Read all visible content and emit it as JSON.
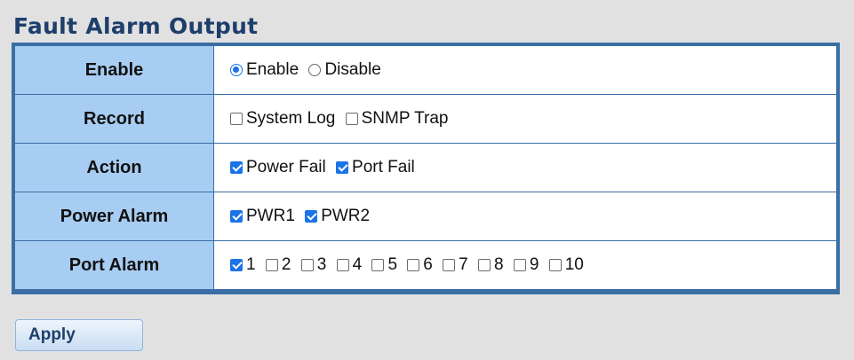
{
  "title": "Fault Alarm Output",
  "rows": {
    "enable": {
      "label": "Enable",
      "options": [
        {
          "text": "Enable",
          "checked": true
        },
        {
          "text": "Disable",
          "checked": false
        }
      ]
    },
    "record": {
      "label": "Record",
      "options": [
        {
          "text": "System Log",
          "checked": false
        },
        {
          "text": "SNMP Trap",
          "checked": false
        }
      ]
    },
    "action": {
      "label": "Action",
      "options": [
        {
          "text": "Power Fail",
          "checked": true
        },
        {
          "text": "Port Fail",
          "checked": true
        }
      ]
    },
    "power_alarm": {
      "label": "Power Alarm",
      "options": [
        {
          "text": "PWR1",
          "checked": true
        },
        {
          "text": "PWR2",
          "checked": true
        }
      ]
    },
    "port_alarm": {
      "label": "Port Alarm",
      "options": [
        {
          "text": "1",
          "checked": true
        },
        {
          "text": "2",
          "checked": false
        },
        {
          "text": "3",
          "checked": false
        },
        {
          "text": "4",
          "checked": false
        },
        {
          "text": "5",
          "checked": false
        },
        {
          "text": "6",
          "checked": false
        },
        {
          "text": "7",
          "checked": false
        },
        {
          "text": "8",
          "checked": false
        },
        {
          "text": "9",
          "checked": false
        },
        {
          "text": "10",
          "checked": false
        }
      ]
    }
  },
  "apply_label": "Apply",
  "colors": {
    "accent": "#1a73e8",
    "label_bg": "#a8cdf2",
    "border": "#3a6ea5",
    "title": "#1e3f6b"
  }
}
